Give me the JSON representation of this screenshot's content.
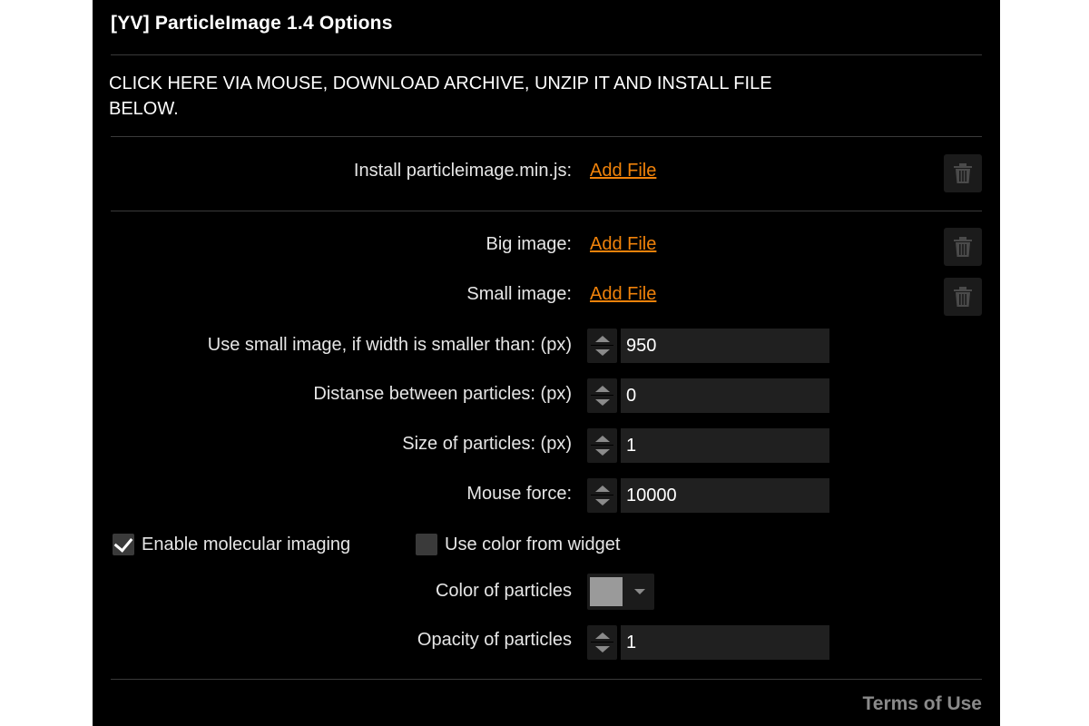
{
  "dialog": {
    "title": "[YV] ParticleImage 1.4 Options",
    "instructions": "CLICK HERE VIA MOUSE, DOWNLOAD ARCHIVE, UNZIP IT AND INSTALL FILE BELOW."
  },
  "files": [
    {
      "label": "Install particleimage.min.js:",
      "link": "Add File",
      "icon": "trash-icon"
    },
    {
      "label": "Big image:",
      "link": "Add File",
      "icon": "trash-icon"
    },
    {
      "label": "Small image:",
      "link": "Add File",
      "icon": "trash-icon"
    }
  ],
  "number_fields": [
    {
      "label": "Use small image, if width is smaller than: (px)",
      "value": "950"
    },
    {
      "label": "Distanse between particles: (px)",
      "value": "0"
    },
    {
      "label": "Size of particles: (px)",
      "value": "1"
    },
    {
      "label": "Mouse force:",
      "value": "10000"
    }
  ],
  "checkboxes": [
    {
      "label": "Enable molecular imaging",
      "checked": true
    },
    {
      "label": "Use color from widget",
      "checked": false
    }
  ],
  "color_field": {
    "label": "Color of particles",
    "value": "#9a9a9a"
  },
  "opacity_field": {
    "label": "Opacity of particles",
    "value": "1"
  },
  "footer": {
    "terms_label": "Terms of Use"
  },
  "colors": {
    "background": "#000000",
    "link": "#f0820a",
    "muted": "#8a8a8a"
  }
}
